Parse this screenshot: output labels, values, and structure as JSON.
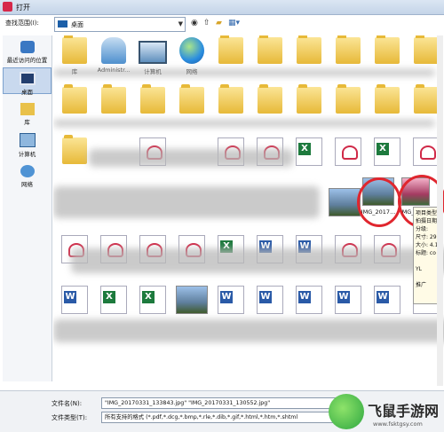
{
  "window": {
    "title": "打开"
  },
  "toolbar": {
    "lookin_label": "查找范围(I):",
    "lookin_value": "桌面"
  },
  "nav": {
    "items": [
      {
        "label": "最近访问的位置",
        "icon": "recent-places-icon"
      },
      {
        "label": "桌面",
        "icon": "desktop-icon",
        "selected": true
      },
      {
        "label": "库",
        "icon": "library-icon"
      },
      {
        "label": "计算机",
        "icon": "computer-icon"
      },
      {
        "label": "网络",
        "icon": "network-icon"
      }
    ]
  },
  "files": {
    "top_row": [
      {
        "label": "库",
        "icon": "library-folder-icon"
      },
      {
        "label": "Administr...",
        "icon": "user-folder-icon"
      },
      {
        "label": "计算机",
        "icon": "computer-icon"
      },
      {
        "label": "网络",
        "icon": "network-icon"
      }
    ],
    "highlighted": [
      {
        "label": "IMG_2017...",
        "icon": "photo-thumbnail-icon"
      },
      {
        "label": "IMG_201...",
        "icon": "photo-thumbnail-icon"
      }
    ]
  },
  "tooltip": {
    "lines": [
      "项目类型",
      "拍摄日期",
      "分级:",
      "尺寸: 29",
      "大小: 4.1",
      "标题: co",
      "",
      "YL",
      "",
      "推广"
    ]
  },
  "bottom": {
    "filename_label": "文件名(N):",
    "filename_value": "\"IMG_20170331_133843.jpg\" \"IMG_20170331_130552.jpg\"",
    "filetype_label": "文件类型(T):",
    "filetype_value": "所有支持的格式 (*.pdf,*.dcg,*.bmp,*.rle,*.dib,*.gif,*.html,*.htm,*.shtml"
  },
  "watermark": {
    "text": "飞鼠手游网",
    "sub": "www.fsktgsy.com"
  },
  "colors": {
    "highlight_circle": "#e0262e",
    "selection": "#c9d9ee"
  }
}
